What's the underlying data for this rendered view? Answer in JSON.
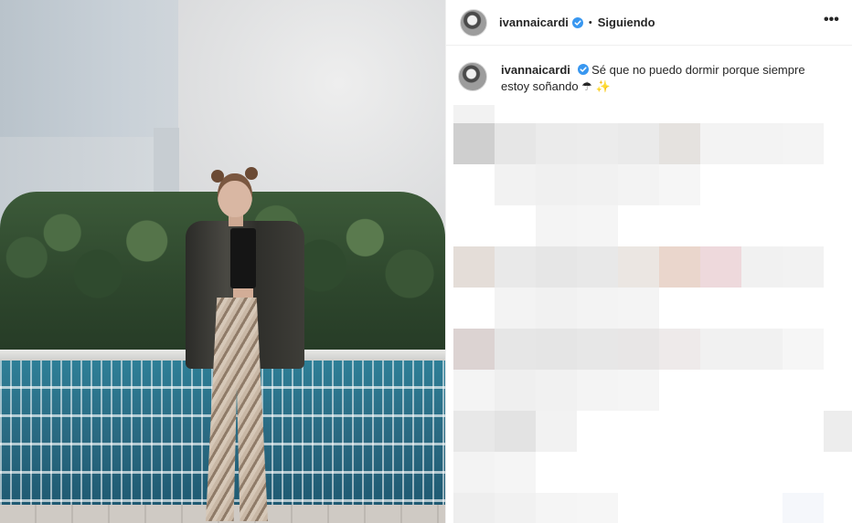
{
  "post": {
    "author": "ivannaicardi",
    "separator": "•",
    "follow_status": "Siguiendo",
    "more_icon": "more-options-icon",
    "verified_color": "#3897f0"
  },
  "caption": {
    "author": "ivannaicardi",
    "text": "Sé que no puedo dormir porque siempre estoy soñando ☂ ✨"
  }
}
